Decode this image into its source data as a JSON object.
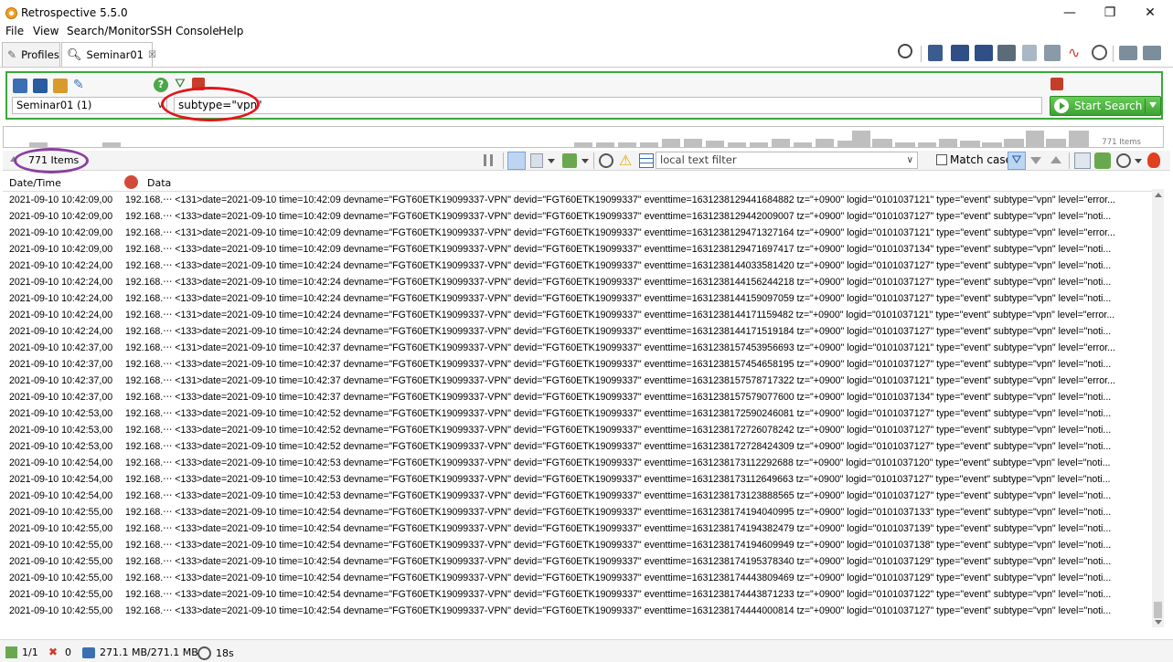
{
  "window": {
    "title": "Retrospective 5.5.0",
    "minimize": "—",
    "maximize": "❐",
    "close": "✕"
  },
  "menu": [
    "File",
    "View",
    "Search/Monitor",
    "SSH Console",
    "Help"
  ],
  "tabs": [
    {
      "label": "Profiles"
    },
    {
      "label": "Seminar01",
      "close": "☒"
    }
  ],
  "search": {
    "profile": "Seminar01 (1)",
    "query": "subtype=\"vpn\"",
    "start_label": "Start Search"
  },
  "histogram": {
    "count_label": "771 Items",
    "levels": [
      0.3,
      0.3,
      0.3,
      0.3,
      0.3,
      0.3,
      0.5,
      0.5,
      0.4,
      0.3,
      0.3,
      0.5,
      0.3,
      0.5,
      0.4,
      1.0,
      0.5,
      0.3,
      0.3,
      0.5,
      0.4,
      0.3,
      0.5,
      1.0,
      0.5,
      1.0
    ]
  },
  "results": {
    "count_label": "771 Items",
    "local_filter_placeholder": "local text filter",
    "match_case_label": "Match case"
  },
  "table": {
    "columns": [
      "Date/Time",
      "Data"
    ],
    "rows": [
      [
        "2021-09-10 10:42:09,00",
        "192.168.‧‧‧ <131>date=2021-09-10 time=10:42:09 devname=\"FGT60ETK19099337-VPN\" devid=\"FGT60ETK19099337\" eventtime=1631238129441684882 tz=\"+0900\" logid=\"0101037121\" type=\"event\" subtype=\"vpn\" level=\"error..."
      ],
      [
        "2021-09-10 10:42:09,00",
        "192.168.‧‧‧ <133>date=2021-09-10 time=10:42:09 devname=\"FGT60ETK19099337-VPN\" devid=\"FGT60ETK19099337\" eventtime=1631238129442009007 tz=\"+0900\" logid=\"0101037127\" type=\"event\" subtype=\"vpn\" level=\"noti..."
      ],
      [
        "2021-09-10 10:42:09,00",
        "192.168.‧‧‧ <131>date=2021-09-10 time=10:42:09 devname=\"FGT60ETK19099337-VPN\" devid=\"FGT60ETK19099337\" eventtime=1631238129471327164 tz=\"+0900\" logid=\"0101037121\" type=\"event\" subtype=\"vpn\" level=\"error..."
      ],
      [
        "2021-09-10 10:42:09,00",
        "192.168.‧‧‧ <133>date=2021-09-10 time=10:42:09 devname=\"FGT60ETK19099337-VPN\" devid=\"FGT60ETK19099337\" eventtime=1631238129471697417 tz=\"+0900\" logid=\"0101037134\" type=\"event\" subtype=\"vpn\" level=\"noti..."
      ],
      [
        "2021-09-10 10:42:24,00",
        "192.168.‧‧‧ <133>date=2021-09-10 time=10:42:24 devname=\"FGT60ETK19099337-VPN\" devid=\"FGT60ETK19099337\" eventtime=1631238144033581420 tz=\"+0900\" logid=\"0101037127\" type=\"event\" subtype=\"vpn\" level=\"noti..."
      ],
      [
        "2021-09-10 10:42:24,00",
        "192.168.‧‧‧ <133>date=2021-09-10 time=10:42:24 devname=\"FGT60ETK19099337-VPN\" devid=\"FGT60ETK19099337\" eventtime=1631238144156244218 tz=\"+0900\" logid=\"0101037127\" type=\"event\" subtype=\"vpn\" level=\"noti..."
      ],
      [
        "2021-09-10 10:42:24,00",
        "192.168.‧‧‧ <133>date=2021-09-10 time=10:42:24 devname=\"FGT60ETK19099337-VPN\" devid=\"FGT60ETK19099337\" eventtime=1631238144159097059 tz=\"+0900\" logid=\"0101037127\" type=\"event\" subtype=\"vpn\" level=\"noti..."
      ],
      [
        "2021-09-10 10:42:24,00",
        "192.168.‧‧‧ <131>date=2021-09-10 time=10:42:24 devname=\"FGT60ETK19099337-VPN\" devid=\"FGT60ETK19099337\" eventtime=1631238144171159482 tz=\"+0900\" logid=\"0101037121\" type=\"event\" subtype=\"vpn\" level=\"error..."
      ],
      [
        "2021-09-10 10:42:24,00",
        "192.168.‧‧‧ <133>date=2021-09-10 time=10:42:24 devname=\"FGT60ETK19099337-VPN\" devid=\"FGT60ETK19099337\" eventtime=1631238144171519184 tz=\"+0900\" logid=\"0101037127\" type=\"event\" subtype=\"vpn\" level=\"noti..."
      ],
      [
        "2021-09-10 10:42:37,00",
        "192.168.‧‧‧ <131>date=2021-09-10 time=10:42:37 devname=\"FGT60ETK19099337-VPN\" devid=\"FGT60ETK19099337\" eventtime=1631238157453956693 tz=\"+0900\" logid=\"0101037121\" type=\"event\" subtype=\"vpn\" level=\"error..."
      ],
      [
        "2021-09-10 10:42:37,00",
        "192.168.‧‧‧ <133>date=2021-09-10 time=10:42:37 devname=\"FGT60ETK19099337-VPN\" devid=\"FGT60ETK19099337\" eventtime=1631238157454658195 tz=\"+0900\" logid=\"0101037127\" type=\"event\" subtype=\"vpn\" level=\"noti..."
      ],
      [
        "2021-09-10 10:42:37,00",
        "192.168.‧‧‧ <131>date=2021-09-10 time=10:42:37 devname=\"FGT60ETK19099337-VPN\" devid=\"FGT60ETK19099337\" eventtime=1631238157578717322 tz=\"+0900\" logid=\"0101037121\" type=\"event\" subtype=\"vpn\" level=\"error..."
      ],
      [
        "2021-09-10 10:42:37,00",
        "192.168.‧‧‧ <133>date=2021-09-10 time=10:42:37 devname=\"FGT60ETK19099337-VPN\" devid=\"FGT60ETK19099337\" eventtime=1631238157579077600 tz=\"+0900\" logid=\"0101037134\" type=\"event\" subtype=\"vpn\" level=\"noti..."
      ],
      [
        "2021-09-10 10:42:53,00",
        "192.168.‧‧‧ <133>date=2021-09-10 time=10:42:52 devname=\"FGT60ETK19099337-VPN\" devid=\"FGT60ETK19099337\" eventtime=1631238172590246081 tz=\"+0900\" logid=\"0101037127\" type=\"event\" subtype=\"vpn\" level=\"noti..."
      ],
      [
        "2021-09-10 10:42:53,00",
        "192.168.‧‧‧ <133>date=2021-09-10 time=10:42:52 devname=\"FGT60ETK19099337-VPN\" devid=\"FGT60ETK19099337\" eventtime=1631238172726078242 tz=\"+0900\" logid=\"0101037127\" type=\"event\" subtype=\"vpn\" level=\"noti..."
      ],
      [
        "2021-09-10 10:42:53,00",
        "192.168.‧‧‧ <133>date=2021-09-10 time=10:42:52 devname=\"FGT60ETK19099337-VPN\" devid=\"FGT60ETK19099337\" eventtime=1631238172728424309 tz=\"+0900\" logid=\"0101037127\" type=\"event\" subtype=\"vpn\" level=\"noti..."
      ],
      [
        "2021-09-10 10:42:54,00",
        "192.168.‧‧‧ <133>date=2021-09-10 time=10:42:53 devname=\"FGT60ETK19099337-VPN\" devid=\"FGT60ETK19099337\" eventtime=1631238173112292688 tz=\"+0900\" logid=\"0101037120\" type=\"event\" subtype=\"vpn\" level=\"noti..."
      ],
      [
        "2021-09-10 10:42:54,00",
        "192.168.‧‧‧ <133>date=2021-09-10 time=10:42:53 devname=\"FGT60ETK19099337-VPN\" devid=\"FGT60ETK19099337\" eventtime=1631238173112649663 tz=\"+0900\" logid=\"0101037127\" type=\"event\" subtype=\"vpn\" level=\"noti..."
      ],
      [
        "2021-09-10 10:42:54,00",
        "192.168.‧‧‧ <133>date=2021-09-10 time=10:42:53 devname=\"FGT60ETK19099337-VPN\" devid=\"FGT60ETK19099337\" eventtime=1631238173123888565 tz=\"+0900\" logid=\"0101037127\" type=\"event\" subtype=\"vpn\" level=\"noti..."
      ],
      [
        "2021-09-10 10:42:55,00",
        "192.168.‧‧‧ <133>date=2021-09-10 time=10:42:54 devname=\"FGT60ETK19099337-VPN\" devid=\"FGT60ETK19099337\" eventtime=1631238174194040995 tz=\"+0900\" logid=\"0101037133\" type=\"event\" subtype=\"vpn\" level=\"noti..."
      ],
      [
        "2021-09-10 10:42:55,00",
        "192.168.‧‧‧ <133>date=2021-09-10 time=10:42:54 devname=\"FGT60ETK19099337-VPN\" devid=\"FGT60ETK19099337\" eventtime=1631238174194382479 tz=\"+0900\" logid=\"0101037139\" type=\"event\" subtype=\"vpn\" level=\"noti..."
      ],
      [
        "2021-09-10 10:42:55,00",
        "192.168.‧‧‧ <133>date=2021-09-10 time=10:42:54 devname=\"FGT60ETK19099337-VPN\" devid=\"FGT60ETK19099337\" eventtime=1631238174194609949 tz=\"+0900\" logid=\"0101037138\" type=\"event\" subtype=\"vpn\" level=\"noti..."
      ],
      [
        "2021-09-10 10:42:55,00",
        "192.168.‧‧‧ <133>date=2021-09-10 time=10:42:54 devname=\"FGT60ETK19099337-VPN\" devid=\"FGT60ETK19099337\" eventtime=1631238174195378340 tz=\"+0900\" logid=\"0101037129\" type=\"event\" subtype=\"vpn\" level=\"noti..."
      ],
      [
        "2021-09-10 10:42:55,00",
        "192.168.‧‧‧ <133>date=2021-09-10 time=10:42:54 devname=\"FGT60ETK19099337-VPN\" devid=\"FGT60ETK19099337\" eventtime=1631238174443809469 tz=\"+0900\" logid=\"0101037129\" type=\"event\" subtype=\"vpn\" level=\"noti..."
      ],
      [
        "2021-09-10 10:42:55,00",
        "192.168.‧‧‧ <133>date=2021-09-10 time=10:42:54 devname=\"FGT60ETK19099337-VPN\" devid=\"FGT60ETK19099337\" eventtime=1631238174443871233 tz=\"+0900\" logid=\"0101037122\" type=\"event\" subtype=\"vpn\" level=\"noti..."
      ],
      [
        "2021-09-10 10:42:55,00",
        "192.168.‧‧‧ <133>date=2021-09-10 time=10:42:54 devname=\"FGT60ETK19099337-VPN\" devid=\"FGT60ETK19099337\" eventtime=1631238174444000814 tz=\"+0900\" logid=\"0101037127\" type=\"event\" subtype=\"vpn\" level=\"noti..."
      ]
    ]
  },
  "status": {
    "pages": "1/1",
    "errors": "0",
    "memory": "271.1 MB/271.1 MB",
    "elapsed": "18s"
  },
  "colors": {
    "accent_green": "#39a83b",
    "annotation_red": "#e0161b",
    "annotation_purple": "#8a3fa0"
  }
}
